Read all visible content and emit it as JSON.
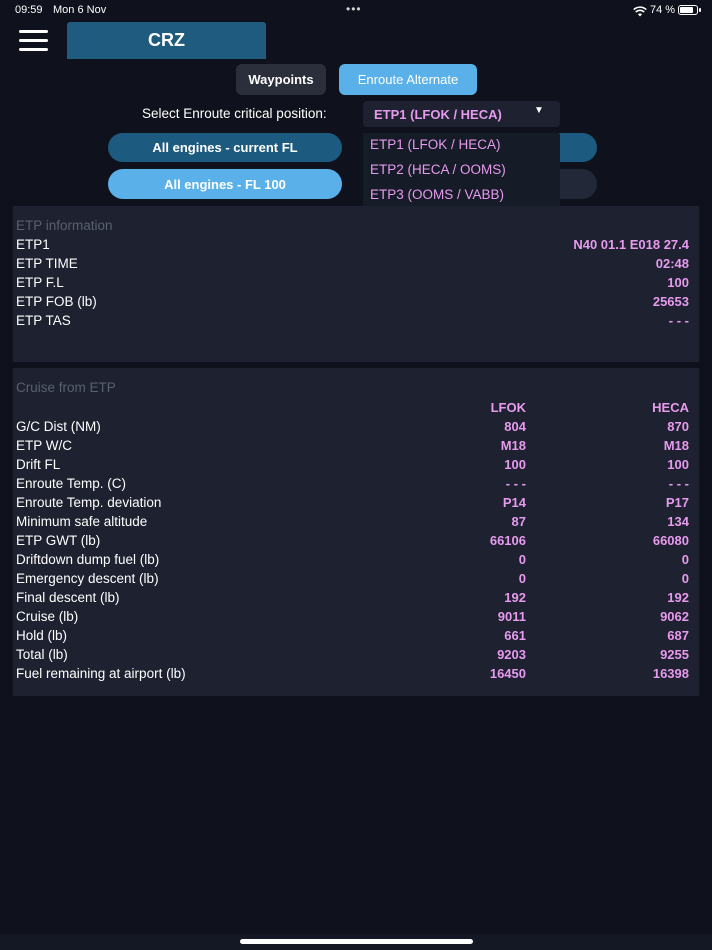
{
  "status_bar": {
    "time": "09:59",
    "date": "Mon 6 Nov",
    "dots": "•••",
    "battery": "74 %",
    "wifi_icon": "wifi-icon"
  },
  "header": {
    "tab_label": "CRZ",
    "menu_icon": "hamburger-menu-icon"
  },
  "mode_buttons": {
    "waypoints": "Waypoints",
    "enroute_alternate": "Enroute Alternate"
  },
  "selector": {
    "label": "Select Enroute critical position:",
    "selected": "ETP1 (LFOK / HECA)",
    "options": [
      "ETP1 (LFOK / HECA)",
      "ETP2 (HECA / OOMS)",
      "ETP3 (OOMS / VABB)"
    ]
  },
  "engine_buttons": {
    "current_fl": "All engines - current FL",
    "fl100": "All engines - FL 100"
  },
  "etp_info": {
    "title": "ETP information",
    "rows": [
      {
        "label": "ETP1",
        "value": "N40 01.1 E018 27.4"
      },
      {
        "label": "ETP TIME",
        "value": "02:48"
      },
      {
        "label": "ETP F.L",
        "value": "100"
      },
      {
        "label": "ETP FOB (lb)",
        "value": "25653"
      },
      {
        "label": "ETP TAS",
        "value": "- - -"
      }
    ]
  },
  "cruise": {
    "title": "Cruise from ETP",
    "columns": [
      "LFOK",
      "HECA"
    ],
    "rows": [
      {
        "label": "G/C Dist (NM)",
        "a": "804",
        "b": "870"
      },
      {
        "label": "ETP W/C",
        "a": "M18",
        "b": "M18"
      },
      {
        "label": "Drift FL",
        "a": "100",
        "b": "100"
      },
      {
        "label": "Enroute Temp. (C)",
        "a": "- - -",
        "b": "- - -"
      },
      {
        "label": "Enroute Temp. deviation",
        "a": "P14",
        "b": "P17"
      },
      {
        "label": "Minimum safe altitude",
        "a": "87",
        "b": "134"
      },
      {
        "label": "ETP GWT (lb)",
        "a": "66106",
        "b": "66080"
      },
      {
        "label": "Driftdown dump fuel (lb)",
        "a": "0",
        "b": "0"
      },
      {
        "label": "Emergency descent (lb)",
        "a": "0",
        "b": "0"
      },
      {
        "label": "Final descent (lb)",
        "a": "192",
        "b": "192"
      },
      {
        "label": "Cruise (lb)",
        "a": "9011",
        "b": "9062"
      },
      {
        "label": "Hold (lb)",
        "a": "661",
        "b": "687"
      },
      {
        "label": "Total (lb)",
        "a": "9203",
        "b": "9255"
      },
      {
        "label": "Fuel remaining at airport (lb)",
        "a": "16450",
        "b": "16398"
      }
    ]
  }
}
